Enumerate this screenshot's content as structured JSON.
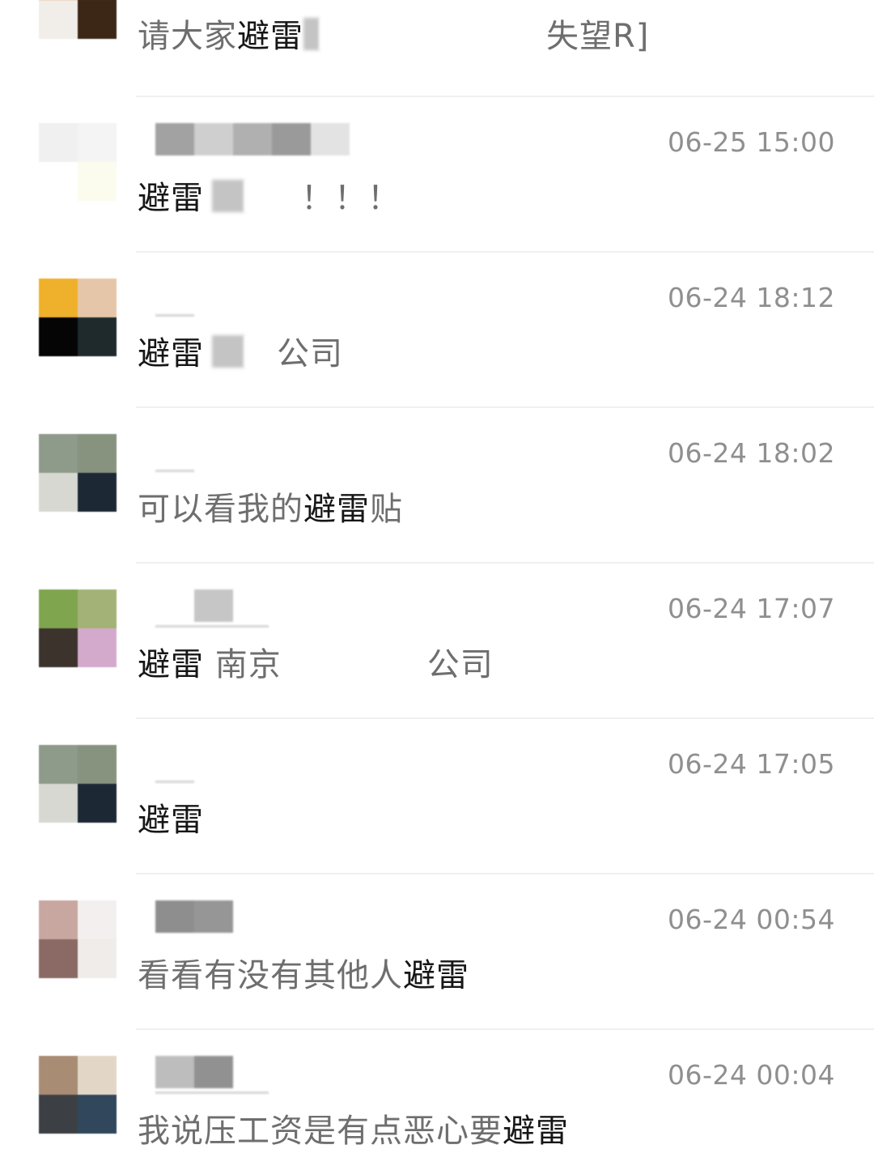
{
  "colors": {
    "keyword": "#161616",
    "message": "#6e6e6e",
    "time": "#8f8f8f",
    "divider": "#f0f0f0"
  },
  "comments": [
    {
      "avatar_colors": [
        "#e8955a",
        "#4a3226",
        "#f1ede8",
        "#3c2616"
      ],
      "name_blocks": [
        "#ffffff",
        "#d2d2d2",
        "#ffffff",
        "#ffffff",
        "#e6e6e6"
      ],
      "time": "",
      "message": {
        "pre": "请大家",
        "kw": "避雷",
        "post": "",
        "suffix": "失望R]"
      }
    },
    {
      "avatar_colors": [
        "#f0f0f0",
        "#f4f4f4",
        "#ffffff",
        "#fbfcee"
      ],
      "name_blocks": [
        "#a2a2a2",
        "#cfcfcf",
        "#b0b0b0",
        "#9a9a9a",
        "#e3e3e3"
      ],
      "time": "06-25 15:00",
      "message": {
        "pre": "",
        "kw": "避雷",
        "post": "",
        "suffix": "！！！"
      }
    },
    {
      "avatar_colors": [
        "#efb02b",
        "#e6c6a8",
        "#050505",
        "#1e2a2c"
      ],
      "name_blocks": [
        "#ffffff",
        "#ffffff"
      ],
      "time": "06-24 18:12",
      "message": {
        "pre": "",
        "kw": "避雷",
        "post": "",
        "suffix": "公司"
      }
    },
    {
      "avatar_colors": [
        "#8e9a8a",
        "#87937f",
        "#d8d8d2",
        "#1c2834"
      ],
      "name_blocks": [
        "#ffffff",
        "#ffffff"
      ],
      "time": "06-24 18:02",
      "message": {
        "pre": "可以看我的",
        "kw": "避雷",
        "post": "贴",
        "suffix": ""
      }
    },
    {
      "avatar_colors": [
        "#7fa54f",
        "#a3b276",
        "#3c332c",
        "#d3aacb"
      ],
      "name_blocks": [
        "#ffffff",
        "#c6c6c6"
      ],
      "time": "06-24 17:07",
      "message": {
        "pre": "",
        "kw": "避雷",
        "post": " 南京",
        "suffix": "公司"
      }
    },
    {
      "avatar_colors": [
        "#8e9a8a",
        "#87937f",
        "#d8d8d2",
        "#1c2834"
      ],
      "name_blocks": [
        "#ffffff",
        "#ffffff"
      ],
      "time": "06-24 17:05",
      "message": {
        "pre": "",
        "kw": "避雷",
        "post": "",
        "suffix": ""
      }
    },
    {
      "avatar_colors": [
        "#c9a7a1",
        "#f3efee",
        "#8b6a65",
        "#efece9"
      ],
      "name_blocks": [
        "#8e8e8e",
        "#969696"
      ],
      "time": "06-24 00:54",
      "message": {
        "pre": "看看有没有其他人",
        "kw": "避雷",
        "post": "",
        "suffix": ""
      }
    },
    {
      "avatar_colors": [
        "#a98c74",
        "#e2d7c7",
        "#3c4045",
        "#30475c"
      ],
      "name_blocks": [
        "#bdbdbd",
        "#919191"
      ],
      "time": "06-24 00:04",
      "message": {
        "pre": "我说压工资是有点恶心要",
        "kw": "避雷",
        "post": "",
        "suffix": ""
      }
    }
  ]
}
